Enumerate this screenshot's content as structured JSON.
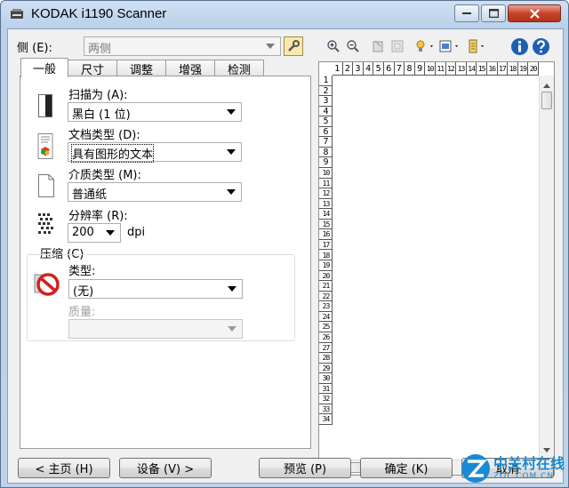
{
  "window": {
    "title": "KODAK i1190 Scanner"
  },
  "toolbar": {
    "side_label": "侧 (E):",
    "side_value": "两侧"
  },
  "tabs": [
    {
      "label": "一般"
    },
    {
      "label": "尺寸"
    },
    {
      "label": "调整"
    },
    {
      "label": "增强"
    },
    {
      "label": "检测"
    }
  ],
  "general": {
    "scan_as_label": "扫描为 (A):",
    "scan_as_value": "黑白 (1 位)",
    "doc_type_label": "文档类型 (D):",
    "doc_type_value": "具有图形的文本",
    "media_type_label": "介质类型 (M):",
    "media_type_value": "普通纸",
    "resolution_label": "分辨率 (R):",
    "resolution_value": "200",
    "resolution_unit": "dpi",
    "compression": {
      "group_label": "压缩 (C)",
      "type_label": "类型:",
      "type_value": "(无)",
      "quality_label": "质量:",
      "quality_value": ""
    }
  },
  "preview": {
    "ruler_h": [
      "1",
      "2",
      "3",
      "4",
      "5",
      "6",
      "7",
      "8",
      "9",
      "10",
      "11",
      "12",
      "13",
      "14",
      "15",
      "16",
      "17",
      "18",
      "19",
      "20"
    ],
    "ruler_v": [
      "1",
      "2",
      "3",
      "4",
      "5",
      "6",
      "7",
      "8",
      "9",
      "10",
      "11",
      "12",
      "13",
      "14",
      "15",
      "16",
      "17",
      "18",
      "19",
      "20",
      "21",
      "22",
      "23",
      "24",
      "25",
      "26",
      "27",
      "28",
      "29",
      "30",
      "31",
      "32",
      "33",
      "34"
    ]
  },
  "buttons": {
    "home": "< 主页 (H)",
    "device": "设备 (V) >",
    "preview": "预览 (P)",
    "ok": "确定 (K)",
    "cancel": "取消"
  },
  "watermark": {
    "brand": "中关村在线",
    "domain": "ZOL.COM.CN"
  },
  "colors": {
    "title_bar": "#bcd3eb",
    "info_blue": "#1e5fb4",
    "no_sign_red": "#d02020"
  }
}
